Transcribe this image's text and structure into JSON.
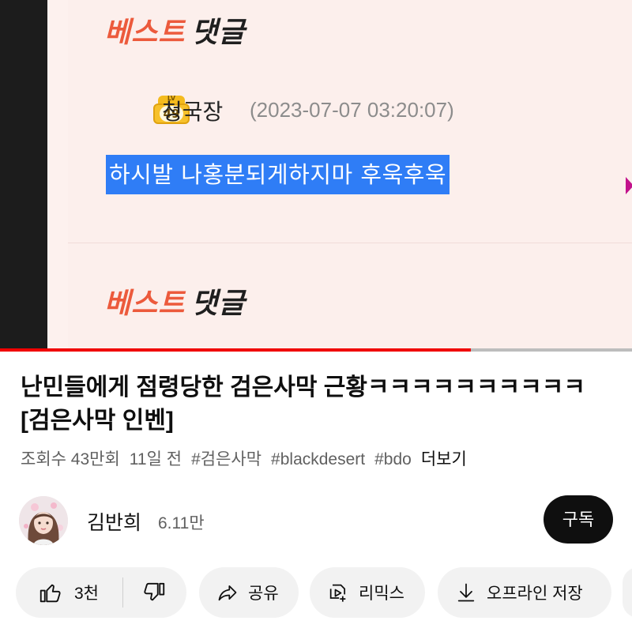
{
  "video_frame": {
    "best_label_1": "베스트",
    "reply_label_1": "댓글",
    "best_label_2": "베스트",
    "reply_label_2": "댓글",
    "comment": {
      "level_badge_top": "LV",
      "level": "49",
      "author": "청국장",
      "date": "(2023-07-07 03:20:07)",
      "text": "하시발 나홍분되게하지마 후욱후욱"
    },
    "progress": 0.745,
    "colors": {
      "progress": "#f00000",
      "selection": "#2f7df6",
      "best": "#ec5a3c"
    }
  },
  "video": {
    "title": "난민들에게 점령당한 검은사막 근황ㅋㅋㅋㅋㅋㅋㅋㅋㅋㅋ[검은사막 인벤]",
    "views": "조회수 43만회",
    "age": "11일 전",
    "tags": [
      "#검은사막",
      "#blackdesert",
      "#bdo"
    ],
    "more": "더보기"
  },
  "channel": {
    "name": "김반희",
    "subscribers": "6.11만",
    "subscribe_label": "구독",
    "avatar_icon": "avatar-photo"
  },
  "actions": {
    "like_count": "3천",
    "like_icon": "thumbs-up-icon",
    "dislike_icon": "thumbs-down-icon",
    "share_label": "공유",
    "share_icon": "share-arrow-icon",
    "remix_label": "리믹스",
    "remix_icon": "remix-icon",
    "offline_label": "오프라인 저장",
    "offline_icon": "download-icon"
  }
}
